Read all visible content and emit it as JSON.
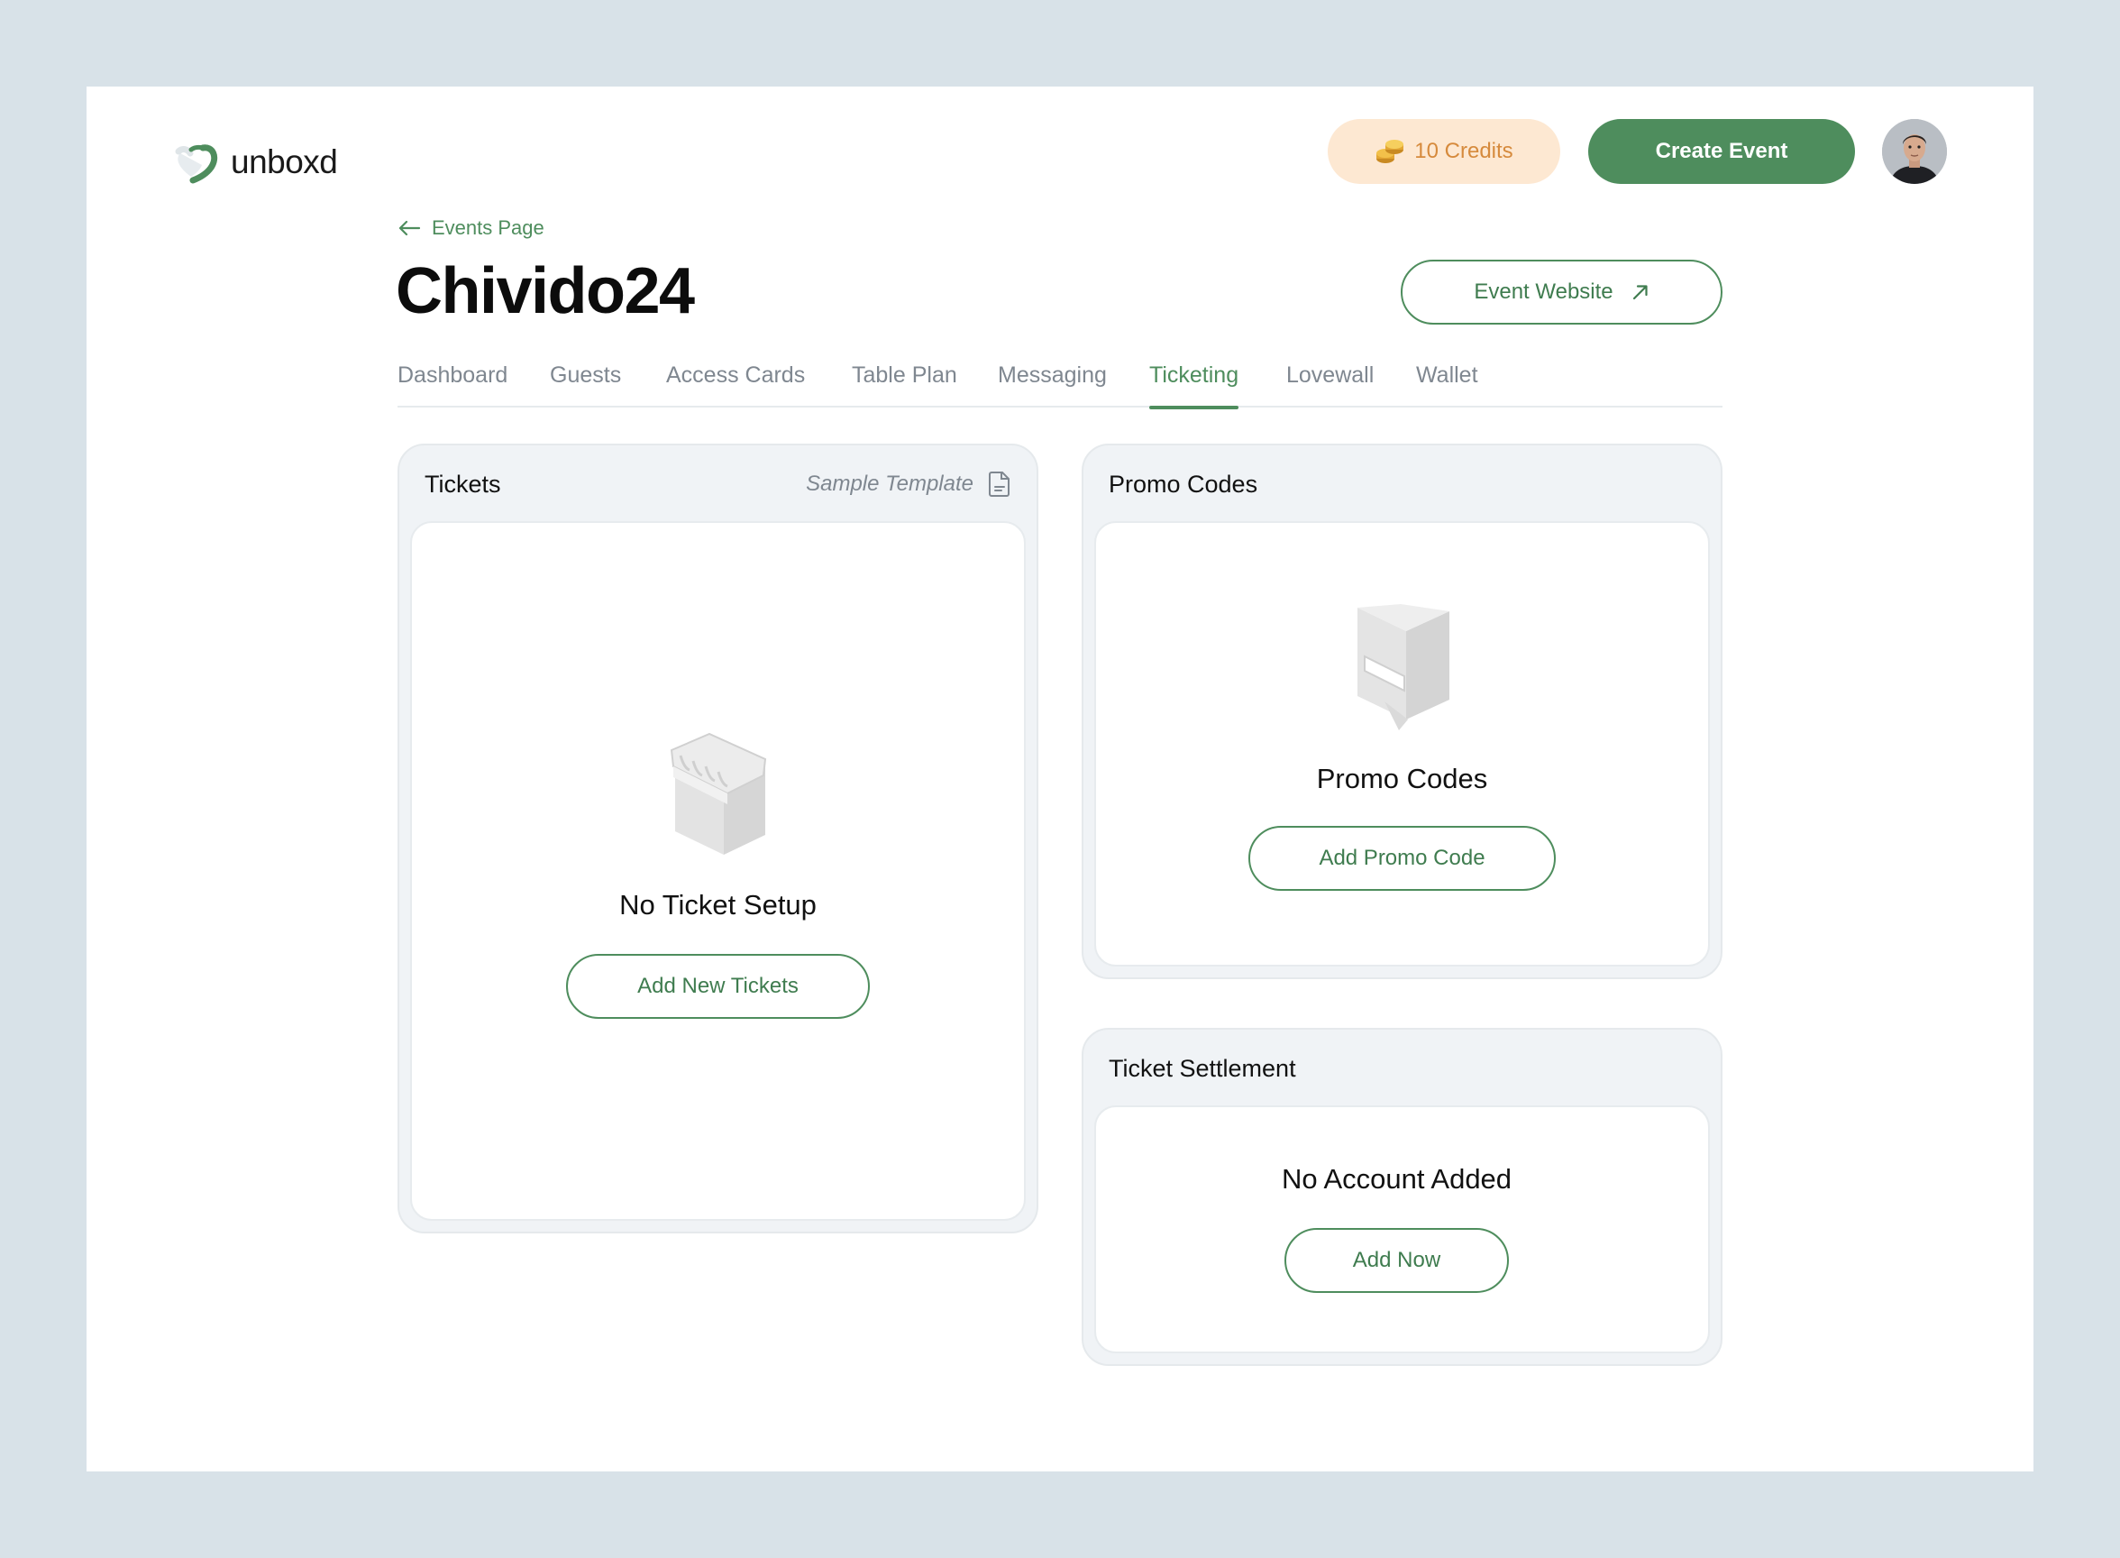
{
  "brand": {
    "name": "unboxd",
    "color": "#4e8d5d"
  },
  "header": {
    "credits_label": "10 Credits",
    "create_event_label": "Create Event",
    "avatar_alt": "user avatar"
  },
  "page": {
    "back_label": "Events Page",
    "title": "Chivido24",
    "website_button_label": "Event Website"
  },
  "tabs": [
    {
      "label": "Dashboard",
      "active": false
    },
    {
      "label": "Guests",
      "active": false
    },
    {
      "label": "Access Cards",
      "active": false
    },
    {
      "label": "Table Plan",
      "active": false
    },
    {
      "label": "Messaging",
      "active": false
    },
    {
      "label": "Ticketing",
      "active": true
    },
    {
      "label": "Lovewall",
      "active": false
    },
    {
      "label": "Wallet",
      "active": false
    }
  ],
  "tickets_card": {
    "title": "Tickets",
    "sample_label": "Sample Template",
    "empty_title": "No Ticket Setup",
    "button_label": "Add New Tickets"
  },
  "promo_card": {
    "title": "Promo Codes",
    "empty_title": "Promo Codes",
    "button_label": "Add Promo Code"
  },
  "settlement_card": {
    "title": "Ticket Settlement",
    "empty_title": "No Account Added",
    "button_label": "Add Now"
  },
  "icons": {
    "credits": "coins-icon",
    "back": "arrow-left-icon",
    "external": "arrow-up-right-icon",
    "sample": "document-icon",
    "ticket_empty": "ticket-booth-icon",
    "promo_empty": "promo-stand-icon"
  }
}
